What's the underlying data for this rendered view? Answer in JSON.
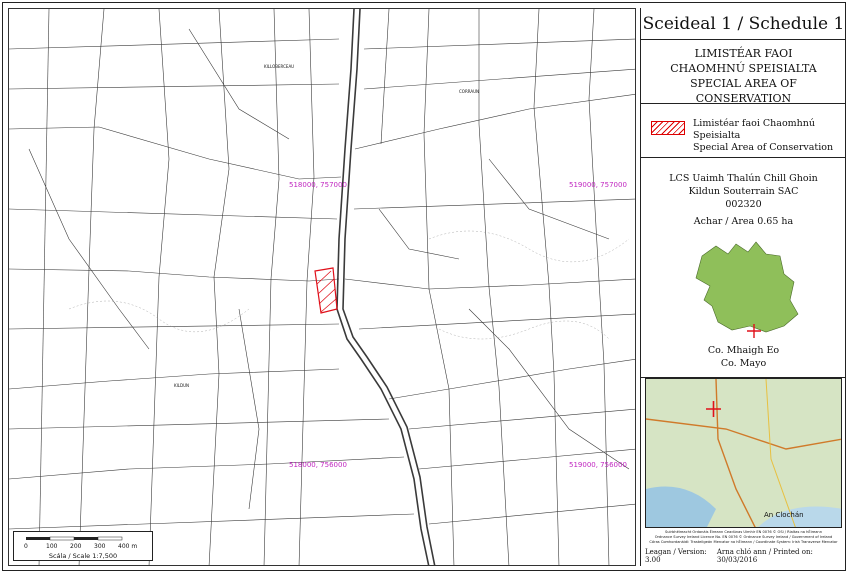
{
  "map": {
    "coords": [
      "518000, 757000",
      "519000, 757000",
      "518000, 756000",
      "519000, 756000"
    ],
    "townland_labels": [
      "KILLOBERCEAU",
      "CORRAUN",
      "KILDUN"
    ],
    "scale_label": "Scála / Scale 1:7,500",
    "scale_ticks": [
      "0",
      "100",
      "200",
      "300",
      "400 m"
    ],
    "colors": {
      "boundary": "#e0101a",
      "lines": "#3a3a3a",
      "coord": "#c026c0"
    }
  },
  "panel": {
    "title": "Sceideal 1 / Schedule 1",
    "subtitle_lines": [
      "LIMISTÉAR FAOI",
      "CHAOMHNÚ SPEISIALTA",
      "SPECIAL AREA OF CONSERVATION"
    ],
    "legend_lines": [
      "Limistéar faoi Chaomhnú Speisialta",
      "Special Area of Conservation"
    ],
    "site_lines": [
      "LCS Uaimh Thalún Chill Ghoin",
      "Kildun Souterrain SAC",
      "002320"
    ],
    "area": "Achar / Area 0.65 ha",
    "county_lines": [
      "Co. Mhaigh Eo",
      "Co. Mayo"
    ],
    "credit_lines": [
      "Suirbhéireacht Ordanáis Éireann Ceadúnas Uimhir EN 0076 © OSi / Rialtas na hÉireann",
      "Ordnance Survey Ireland Licence No. EN 0076 © Ordnance Survey Ireland / Government of Ireland",
      "Córas Comhordanáidí: Trasteilgeán Mercator na hÉireann / Coordinate System: Irish Transverse Mercator"
    ],
    "version": "Leagan / Version: 3.00",
    "printed": "Arna chló ann / Printed on: 30/03/2016",
    "inset_labels": [
      "An Clochán"
    ]
  }
}
